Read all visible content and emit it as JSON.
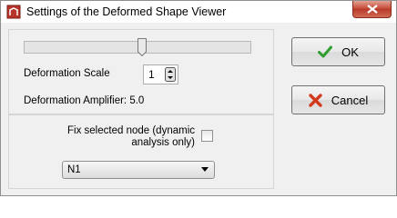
{
  "window": {
    "title": "Settings of the Deformed Shape Viewer",
    "close_icon": "close-icon"
  },
  "deformation": {
    "slider_level_percent": 52,
    "scale_label": "Deformation Scale",
    "scale_value": "1",
    "amplifier_text": "Deformation Amplifier: 5.0"
  },
  "fix_node": {
    "label_line1": "Fix selected node (dynamic",
    "label_line2": "analysis only)",
    "checked": false,
    "node_value": "N1"
  },
  "buttons": {
    "ok_label": "OK",
    "cancel_label": "Cancel"
  },
  "colors": {
    "ok_check": "#2e9e2e",
    "cancel_x": "#d23a1e",
    "close_button": "#c7503a"
  }
}
